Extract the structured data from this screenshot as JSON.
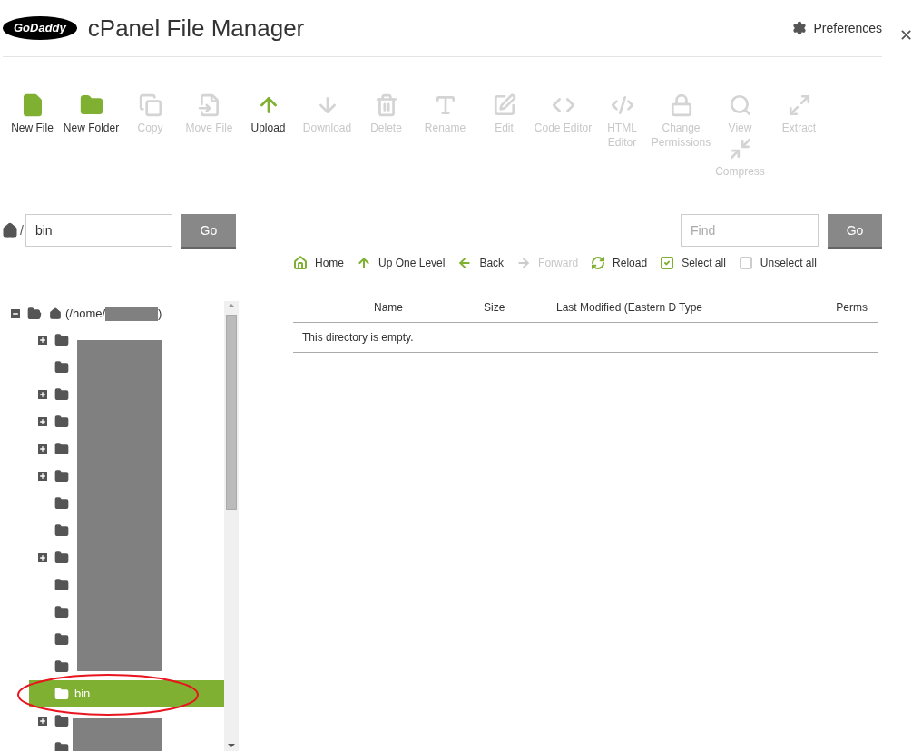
{
  "header": {
    "logo": "GoDaddy",
    "title": "cPanel File Manager",
    "preferences": "Preferences",
    "close": "✕"
  },
  "toolbar": [
    {
      "label": "New File",
      "enabled": true
    },
    {
      "label": "New Folder",
      "enabled": true
    },
    {
      "label": "Copy",
      "enabled": false
    },
    {
      "label": "Move File",
      "enabled": false
    },
    {
      "label": "Upload",
      "enabled": true
    },
    {
      "label": "Download",
      "enabled": false
    },
    {
      "label": "Delete",
      "enabled": false
    },
    {
      "label": "Rename",
      "enabled": false
    },
    {
      "label": "Edit",
      "enabled": false
    },
    {
      "label": "Code Editor",
      "enabled": false
    },
    {
      "label": "HTML Editor",
      "enabled": false
    },
    {
      "label": "Change Permissions",
      "enabled": false
    },
    {
      "label": "View",
      "enabled": false
    },
    {
      "label": "Compress",
      "enabled": false,
      "kind": "stacked"
    },
    {
      "label": "Extract",
      "enabled": false
    }
  ],
  "path": {
    "separator": "/",
    "value": "bin",
    "go": "Go"
  },
  "find": {
    "placeholder": "Find",
    "go": "Go"
  },
  "nav": [
    {
      "label": "Home",
      "enabled": true
    },
    {
      "label": "Up One Level",
      "enabled": true
    },
    {
      "label": "Back",
      "enabled": true
    },
    {
      "label": "Forward",
      "enabled": false
    },
    {
      "label": "Reload",
      "enabled": true
    },
    {
      "label": "Select all",
      "enabled": true
    },
    {
      "label": "Unselect all",
      "enabled": true
    }
  ],
  "tree": {
    "root": {
      "label_start": "(/home/",
      "label_end": ")",
      "expanded": true
    },
    "items": [
      {
        "expandable": true,
        "selected": false
      },
      {
        "expandable": false,
        "selected": false
      },
      {
        "expandable": true,
        "selected": false
      },
      {
        "expandable": true,
        "selected": false
      },
      {
        "expandable": true,
        "selected": false
      },
      {
        "expandable": true,
        "selected": false
      },
      {
        "expandable": false,
        "selected": false
      },
      {
        "expandable": false,
        "selected": false
      },
      {
        "expandable": true,
        "selected": false
      },
      {
        "expandable": false,
        "selected": false
      },
      {
        "expandable": false,
        "selected": false
      },
      {
        "expandable": false,
        "selected": false
      },
      {
        "expandable": false,
        "selected": false
      },
      {
        "label": "bin",
        "expandable": false,
        "selected": true
      },
      {
        "expandable": true,
        "selected": false
      },
      {
        "expandable": false,
        "selected": false
      }
    ]
  },
  "table": {
    "columns": [
      "Name",
      "Size",
      "Last Modified (Eastern D",
      "Type",
      "Perms"
    ],
    "empty_message": "This directory is empty."
  }
}
